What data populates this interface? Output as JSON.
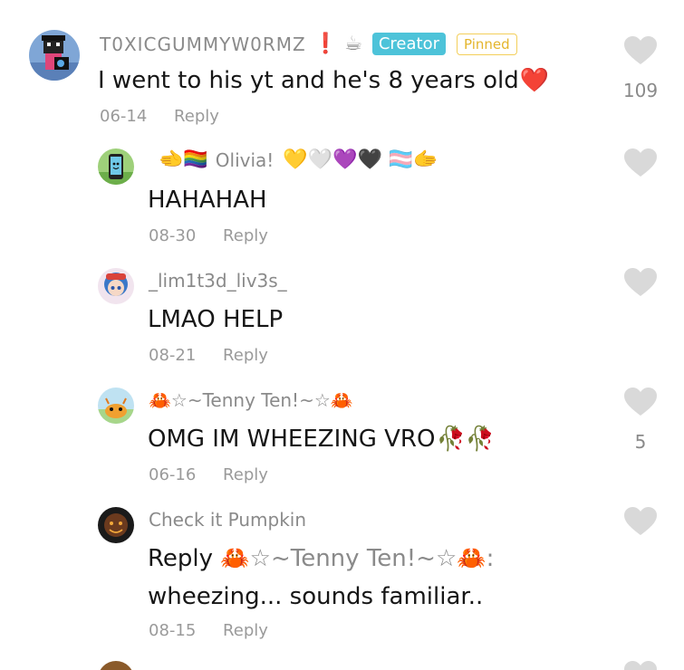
{
  "comments": [
    {
      "username": "T0XICGUMMYW0RMZ",
      "username_emoji": "❗ ☕",
      "badges": {
        "creator": "Creator",
        "pinned": "Pinned"
      },
      "text": "I went to his yt and he's 8 years old",
      "text_emoji": "❤️",
      "date": "06-14",
      "reply_label": "Reply",
      "likes": "109"
    },
    {
      "username_prefix_emoji": "🫲🏳️‍🌈",
      "username": "Olivia!",
      "username_emoji": "💛🤍💜🖤 🏳️‍⚧️🫱",
      "text": "HAHAHAH",
      "date": "08-30",
      "reply_label": "Reply"
    },
    {
      "username": "_lim1t3d_liv3s_",
      "text": "LMAO HELP",
      "date": "08-21",
      "reply_label": "Reply"
    },
    {
      "username": "🦀☆~Tenny Ten!~☆🦀",
      "text": "OMG IM WHEEZING VRO",
      "text_emoji": "🥀🥀",
      "date": "06-16",
      "reply_label": "Reply",
      "likes": "5"
    },
    {
      "username": "Check it Pumpkin",
      "text_line1_prefix": "Reply",
      "text_line1_mention": "🦀☆~Tenny Ten!~☆🦀",
      "text_line1_suffix": ":",
      "text_line2": "wheezing... sounds familiar..",
      "date": "08-15",
      "reply_label": "Reply"
    }
  ],
  "colors": {
    "username": "#8a8a8a",
    "text": "#161616",
    "meta": "#9a9a9a",
    "heart": "#d9d9d9",
    "creator_badge": "#4dc3d9",
    "pinned_badge": "#e4b52c"
  },
  "icons": {
    "like": "heart-icon"
  }
}
